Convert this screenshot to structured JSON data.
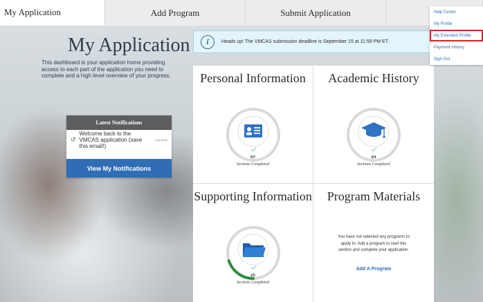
{
  "tabs": [
    {
      "label": "My Application"
    },
    {
      "label": "Add Program"
    },
    {
      "label": "Submit Application"
    },
    {
      "label": ""
    }
  ],
  "left": {
    "title": "My Application",
    "description": "This dashboard is your application home providing access to each part of the application you need to complete and a high level overview of your progress."
  },
  "notifications": {
    "header": "Latest Notifications",
    "item_text": "Welcome back to the VMCAS application (save this email!)",
    "item_time": "Last week",
    "button": "View My Notifications"
  },
  "alert": {
    "text": "Heads up! The VMCAS submission deadline is September 15 at 11:59 PM ET."
  },
  "cards": {
    "personal": {
      "title": "Personal Information",
      "count": "0/7",
      "caption": "Sections Completed",
      "completed": 0,
      "total": 7,
      "icon": "id-card-icon"
    },
    "academic": {
      "title": "Academic History",
      "count": "0/4",
      "caption": "Sections Completed",
      "completed": 0,
      "total": 4,
      "icon": "graduation-cap-icon"
    },
    "supporting": {
      "title": "Supporting Information",
      "count": "1/5",
      "caption": "Sections Completed",
      "completed": 1,
      "total": 5,
      "icon": "folder-icon"
    },
    "program": {
      "title": "Program Materials",
      "text": "You have not selected any programs to apply to. Add a program to start this section and complete your application.",
      "link": "Add A Program"
    }
  },
  "menu": {
    "items": [
      {
        "label": "Help Center"
      },
      {
        "label": "My Profile"
      },
      {
        "label": "My Extended Profile"
      },
      {
        "label": "Payment History"
      },
      {
        "label": "Sign Out"
      }
    ]
  },
  "colors": {
    "primary": "#2f6db6",
    "progress": "#2e8b3c",
    "highlight": "#e02020",
    "icon_bg": "#2f73c4"
  }
}
